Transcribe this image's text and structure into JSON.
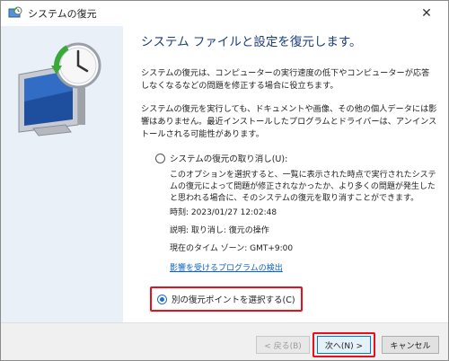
{
  "window": {
    "title": "システムの復元",
    "close_glyph": "✕"
  },
  "main": {
    "heading": "システム ファイルと設定を復元します。",
    "paragraph1": "システムの復元は、コンピューターの実行速度の低下やコンピューターが応答しなくなるなどの問題を修正する場合に役立ちます。",
    "paragraph2": "システムの復元を実行しても、ドキュメントや画像、その他の個人データには影響はありません。最近インストールしたプログラムとドライバーは、アンインストールされる可能性があります。",
    "option_undo": {
      "label": "システムの復元の取り消し(U):",
      "checked": false,
      "description": "このオプションを選択すると、一覧に表示された時点で実行されたシステムの復元によって問題が修正されなかったか、より多くの問題が発生したと思われる場合に、そのシステムの復元を取り消すことができます。",
      "time": "時刻: 2023/01/27 12:02:48",
      "desc": "説明: 取り消し: 復元の操作",
      "timezone": "現在のタイム ゾーン: GMT+9:00",
      "link": "影響を受けるプログラムの検出"
    },
    "option_choose": {
      "label": "別の復元ポイントを選択する(C)",
      "checked": true
    }
  },
  "footer": {
    "back_label": "< 戻る(B)",
    "next_label": "次へ(N) >",
    "cancel_label": "キャンセル"
  },
  "colors": {
    "accent": "#1f6fd1",
    "highlight": "#e8101a",
    "heading": "#1a3e78",
    "link": "#0a63c9",
    "side_panel": "#eaf0f8"
  },
  "icons": [
    "system-restore-icon",
    "close-icon",
    "monitor-clock-icon"
  ]
}
